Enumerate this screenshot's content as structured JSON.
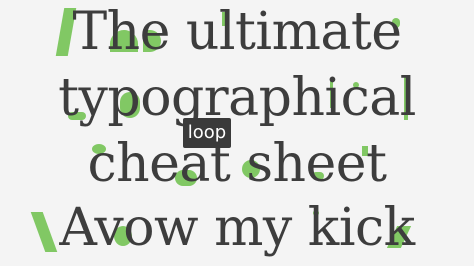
{
  "lines": [
    "The ultimate",
    "typographical",
    "cheat sheet",
    "Avow my kick"
  ],
  "badge": {
    "label": "loop"
  },
  "colors": {
    "background": "#f4f4f4",
    "text": "#3d3d3d",
    "accent": "#6cc04a",
    "badge_bg": "#3a3a3a",
    "badge_text": "#ffffff"
  }
}
